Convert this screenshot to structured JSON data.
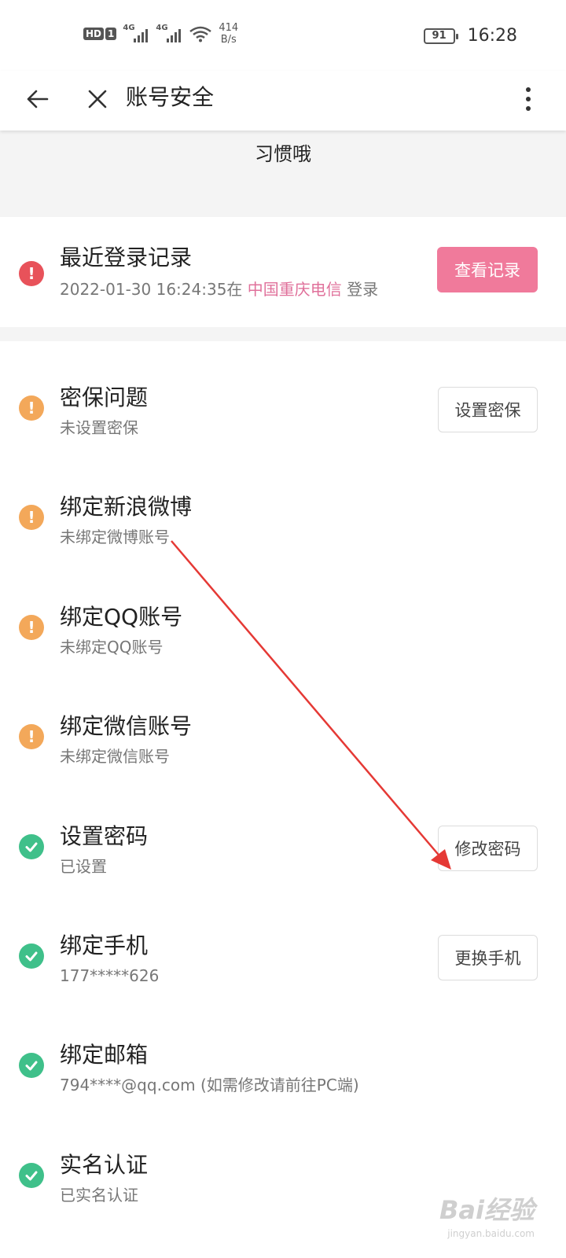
{
  "status_bar": {
    "hd": "HD",
    "sim": "1",
    "net1": "4G",
    "net2": "4G",
    "speed_value": "414",
    "speed_unit": "B/s",
    "battery": "91",
    "time": "16:28"
  },
  "app_bar": {
    "title": "账号安全",
    "back_icon": "arrow-left-icon",
    "close_icon": "close-icon",
    "more_icon": "more-vertical-icon"
  },
  "profile": {
    "nickname": "习惯哦"
  },
  "recent_login": {
    "title": "最近登录记录",
    "datetime": "2022-01-30 16:24:35在",
    "location": "中国重庆电信",
    "suffix": "登录",
    "button": "查看记录",
    "icon": "alert-red-icon"
  },
  "items": [
    {
      "title": "密保问题",
      "sub": "未设置密保",
      "status": "warning",
      "button": "设置密保"
    },
    {
      "title": "绑定新浪微博",
      "sub": "未绑定微博账号",
      "status": "warning",
      "button": ""
    },
    {
      "title": "绑定QQ账号",
      "sub": "未绑定QQ账号",
      "status": "warning",
      "button": ""
    },
    {
      "title": "绑定微信账号",
      "sub": "未绑定微信账号",
      "status": "warning",
      "button": ""
    },
    {
      "title": "设置密码",
      "sub": "已设置",
      "status": "ok",
      "button": "修改密码"
    },
    {
      "title": "绑定手机",
      "sub": "177*****626",
      "status": "ok",
      "button": "更换手机"
    },
    {
      "title": "绑定邮箱",
      "sub": "794****@qq.com (如需修改请前往PC端)",
      "status": "ok",
      "button": ""
    },
    {
      "title": "实名认证",
      "sub": "已实名认证",
      "status": "ok",
      "button": ""
    }
  ],
  "colors": {
    "accent_pink": "#f07a9b",
    "location_pink": "#e0719b",
    "warning_orange": "#f3a85a",
    "ok_green": "#3fc08a",
    "alert_red": "#e8525a",
    "annotation_red": "#e53935"
  },
  "watermark": {
    "logo": "Bai经验",
    "sub": "jingyan.baidu.com"
  }
}
